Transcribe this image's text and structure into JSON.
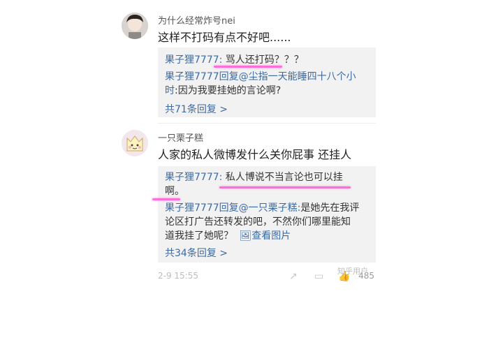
{
  "comments": [
    {
      "username": "为什么经常炸号nei",
      "text": "这样不打码有点不好吧......",
      "replies": [
        {
          "author": "果子狸7777:",
          "body": " 骂人还打码？？？"
        },
        {
          "author": "果子狸7777回复@尘指一天能睡四十八个小",
          "body": ""
        },
        {
          "author": "时",
          "body": ":因为我要挂她的言论啊?"
        }
      ],
      "more": "共71条回复 >"
    },
    {
      "username": "一只栗子糕",
      "text": "人家的私人微博发什么关你屁事 还挂人",
      "replies": [
        {
          "author": "果子狸7777:",
          "body": " 私人博说不当言论也可以挂"
        },
        {
          "author": "",
          "body": "啊。"
        },
        {
          "author": "果子狸7777回复@一只栗子糕:",
          "body": "是她先在我评"
        },
        {
          "author": "",
          "body": "论区打广告还转发的吧，不然你们哪里能知"
        },
        {
          "author": "",
          "body": "道我挂了她呢？"
        },
        {
          "author": "",
          "body": "查看图片"
        }
      ],
      "more": "共34条回复 >"
    }
  ],
  "footer": {
    "time": "2-9 15:55",
    "likes": "485",
    "share_icon": "share-icon",
    "comment_icon": "comment-icon",
    "like_icon": "thumbs-up-icon"
  },
  "watermark": "知乎用户",
  "colors": {
    "link": "#3b6aa3",
    "highlight": "#ff4fd1",
    "reply_bg": "#f2f2f2"
  }
}
